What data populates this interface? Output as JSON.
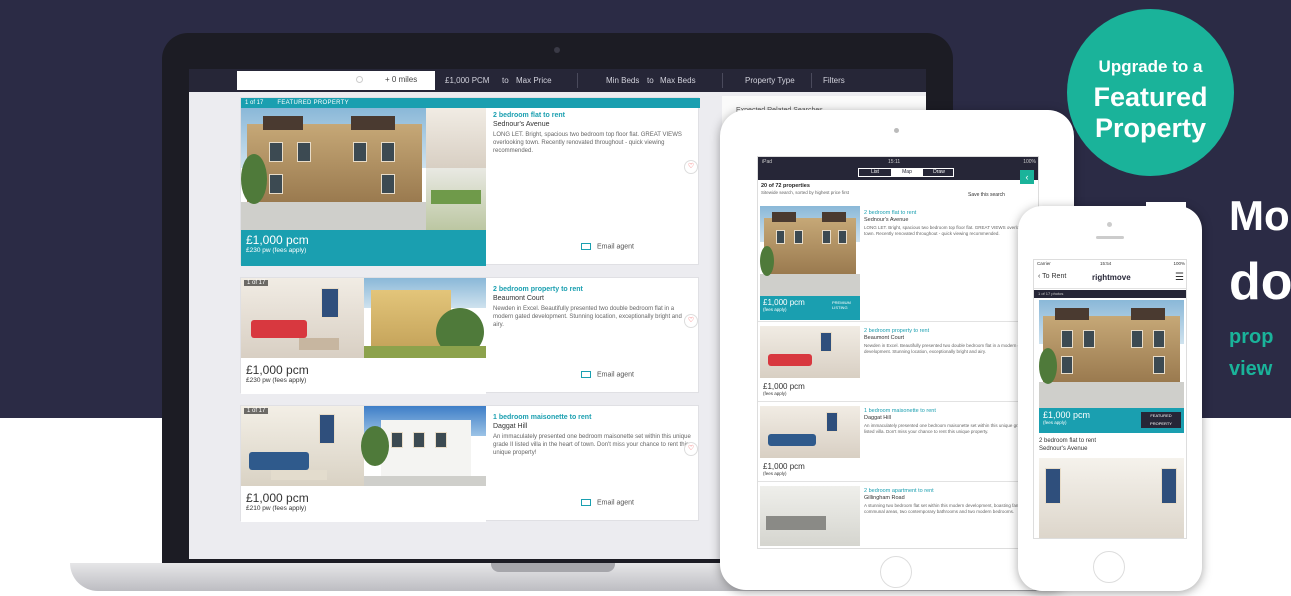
{
  "search": {
    "placeholder": "",
    "radius": "+ 0 miles",
    "min_price": "£1,000 PCM",
    "to1": "to",
    "max_price": "Max Price",
    "min_beds": "Min Beds",
    "to2": "to",
    "max_beds": "Max Beds",
    "property_type": "Property Type",
    "filters": "Filters"
  },
  "sidebar": {
    "title": "Expected Related Searches"
  },
  "listings": [
    {
      "tag": "1 of 17",
      "banner": "FEATURED PROPERTY",
      "title": "2 bedroom flat to rent",
      "address": "Sednour's Avenue",
      "description": "LONG LET. Bright, spacious two bedroom top floor flat. GREAT VIEWS overlooking town. Recently renovated throughout - quick viewing recommended.",
      "price": "£1,000 pcm",
      "price_week": "£230 pw (fees apply)",
      "email": "Email agent"
    },
    {
      "tag": "1 of 17",
      "title": "2 bedroom property to rent",
      "address": "Beaumont Court",
      "description": "Newden in Excel. Beautifully presented two double bedroom flat in a modern gated development. Stunning location, exceptionally bright and airy.",
      "price": "£1,000 pcm",
      "price_week": "£230 pw (fees apply)",
      "email": "Email agent"
    },
    {
      "tag": "1 of 17",
      "title": "1 bedroom maisonette to rent",
      "address": "Daggat Hill",
      "description": "An immaculately presented one bedroom maisonette set within this unique grade II listed villa in the heart of town. Don't miss your chance to rent this unique property!",
      "price": "£1,000 pcm",
      "price_week": "£210 pw (fees apply)",
      "email": "Email agent"
    }
  ],
  "tablet": {
    "status_left": "iPad",
    "status_time": "15:11",
    "status_right": "100%",
    "tabs": [
      "List",
      "Map",
      "Draw"
    ],
    "results": "20 of 72 properties",
    "subtitle": "Sitewide search, sorted by highest price first",
    "save": "Save this search",
    "items": [
      {
        "title": "2 bedroom flat to rent",
        "address": "Sednour's Avenue",
        "desc": "LONG LET. Bright, spacious two bedroom top floor flat. GREAT VIEWS overlooking town. Recently renovated throughout - quick viewing recommended.",
        "price": "£1,000 pcm",
        "week": "(fees apply)",
        "badge": "PREMIUM LISTING"
      },
      {
        "title": "2 bedroom property to rent",
        "address": "Beaumont Court",
        "desc": "Newden in Excel. Beautifully presented two double bedroom flat in a modern gated development. Stunning location, exceptionally bright and airy.",
        "price": "£1,000 pcm",
        "week": "(fees apply)"
      },
      {
        "title": "1 bedroom maisonette to rent",
        "address": "Daggat Hill",
        "desc": "An immaculately presented one bedroom maisonette set within this unique grade II listed villa. Don't miss your chance to rent this unique property.",
        "price": "£1,000 pcm",
        "week": "(fees apply)"
      },
      {
        "title": "2 bedroom apartment to rent",
        "address": "Gillingham Road",
        "desc": "A stunning two bedroom flat set within this modern development, boasting fantastic communal areas, two contemporary bathrooms and two modern bedrooms.",
        "price": "",
        "week": ""
      }
    ]
  },
  "phone": {
    "status_left": "Carrier",
    "status_time": "15:54",
    "status_right": "100%",
    "back": "To Rent",
    "brand": "rightmove",
    "bar": "1 of 17 photos",
    "price": "£1,000 pcm",
    "week": "(fees apply)",
    "badge": "FEATURED PROPERTY",
    "title": "2 bedroom flat to rent",
    "address": "Sednour's Avenue"
  },
  "promo": {
    "line1": "Upgrade to a",
    "line2": "Featured",
    "line3": "Property"
  },
  "side_text": {
    "mo": "Mo",
    "do": "do",
    "prop": "prop",
    "view": "view"
  },
  "colors": {
    "navy": "#2b2b45",
    "teal": "#1a9fb0",
    "promo_green": "#1ab39a"
  }
}
